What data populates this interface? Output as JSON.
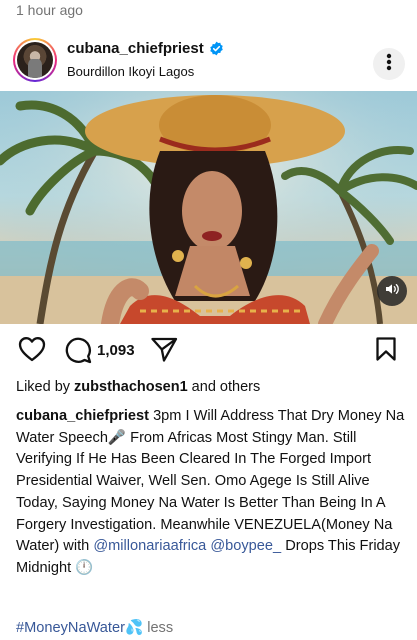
{
  "post": {
    "timestamp": "1 hour ago",
    "username": "cubana_chiefpriest",
    "location": "Bourdillon Ikoyi Lagos"
  },
  "actions": {
    "comment_count": "1,093"
  },
  "likes": {
    "prefix": "Liked by ",
    "user": "zubsthachosen1",
    "suffix": " and others"
  },
  "caption": {
    "username": "cubana_chiefpriest",
    "text_1": " 3pm I Will Address That Dry Money Na Water Speech🎤 From Africas Most Stingy Man. Still Verifying If He Has Been Cleared In The Forged Import Presidential Waiver, Well Sen. Omo Agege Is Still Alive Today, Saying Money Na Water Is Better Than Being In A Forgery Investigation. Meanwhile VENEZUELA(Money Na Water) with ",
    "mention_1": "@millonariaafrica",
    "text_2": " ",
    "mention_2": "@boypee_",
    "text_3": " Drops This Friday Midnight 🕛"
  },
  "footer": {
    "hashtag": "#MoneyNaWater💦",
    "less_label": " less"
  },
  "colors": {
    "link": "#385898",
    "muted": "#737373",
    "verified": "#0095f6"
  },
  "icons": [
    "heart-icon",
    "comment-icon",
    "share-icon",
    "bookmark-icon",
    "more-icon",
    "verified-icon",
    "audio-icon"
  ]
}
